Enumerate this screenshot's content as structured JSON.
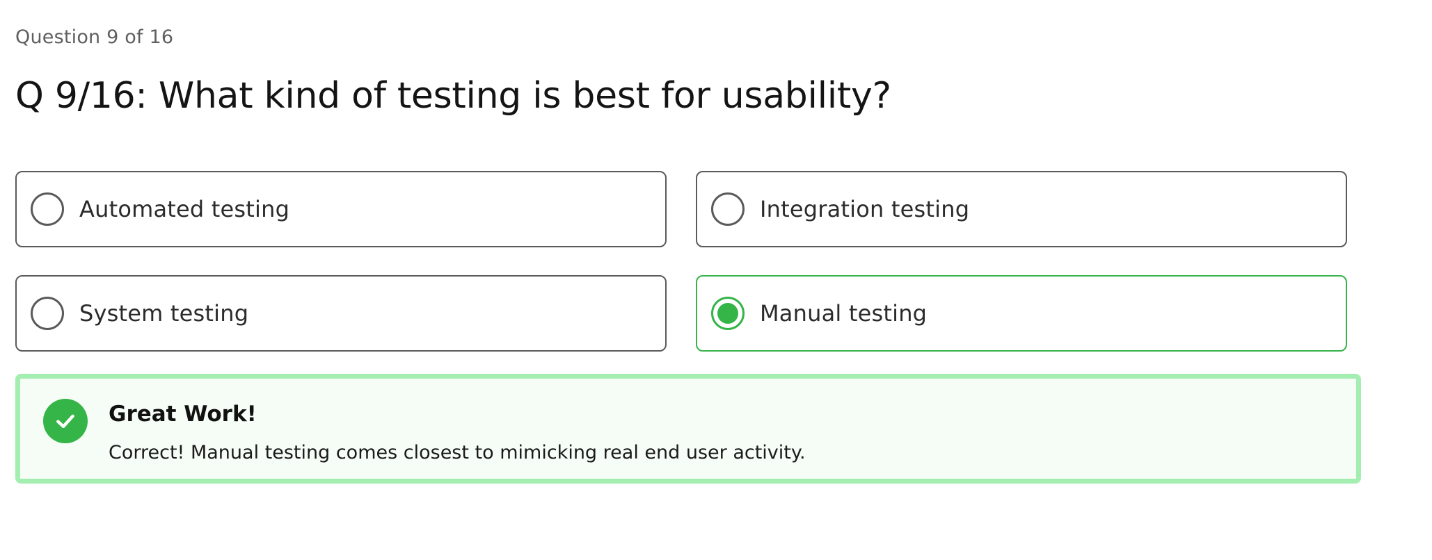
{
  "quiz": {
    "progress_text": "Question 9 of 16",
    "question_text": "Q 9/16: What kind of testing is best for usability?",
    "options": [
      {
        "label": "Automated testing",
        "selected": false
      },
      {
        "label": "Integration testing",
        "selected": false
      },
      {
        "label": "System testing",
        "selected": false
      },
      {
        "label": "Manual testing",
        "selected": true
      }
    ]
  },
  "feedback": {
    "icon": "check-icon",
    "title": "Great Work!",
    "message": "Correct! Manual testing comes closest to mimicking real end user activity."
  },
  "colors": {
    "correct": "#35b448",
    "feedback_border": "#a5eeb1",
    "feedback_background": "#f6fdf6",
    "option_border": "#5a5a5a"
  }
}
